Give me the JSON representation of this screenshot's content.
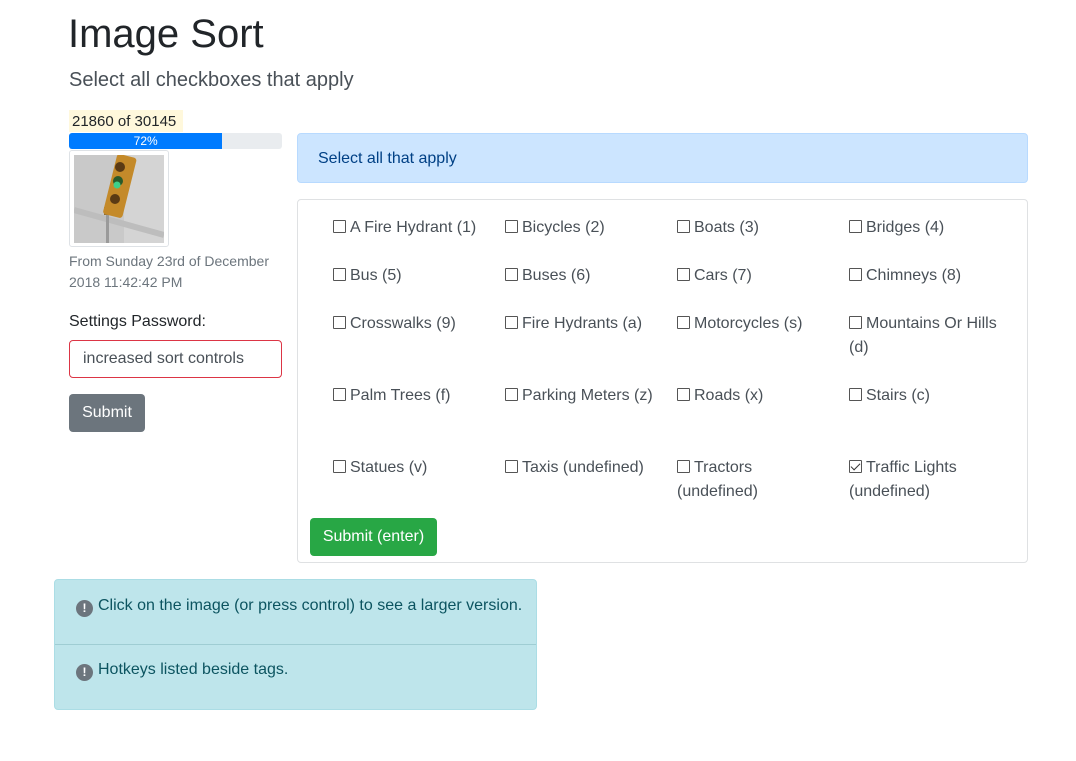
{
  "header": {
    "title": "Image Sort",
    "subtitle": "Select all checkboxes that apply"
  },
  "progress": {
    "counter": "21860 of 30145",
    "percent_label": "72%",
    "fraction": 0.72
  },
  "image": {
    "icon": "traffic-light-thumbnail",
    "caption": "From Sunday 23rd of December 2018 11:42:42 PM"
  },
  "settings": {
    "password_label": "Settings Password:",
    "password_value": "increased sort controls",
    "submit_label": "Submit"
  },
  "alert": {
    "text": "Select all that apply"
  },
  "tags": [
    {
      "label": "A Fire Hydrant (1)",
      "checked": false
    },
    {
      "label": "Bicycles (2)",
      "checked": false
    },
    {
      "label": "Boats (3)",
      "checked": false
    },
    {
      "label": "Bridges (4)",
      "checked": false
    },
    {
      "label": "Bus (5)",
      "checked": false
    },
    {
      "label": "Buses (6)",
      "checked": false
    },
    {
      "label": "Cars (7)",
      "checked": false
    },
    {
      "label": "Chimneys (8)",
      "checked": false
    },
    {
      "label": "Crosswalks (9)",
      "checked": false
    },
    {
      "label": "Fire Hydrants (a)",
      "checked": false
    },
    {
      "label": "Motorcycles (s)",
      "checked": false
    },
    {
      "label": "Mountains Or Hills (d)",
      "checked": false
    },
    {
      "label": "Palm Trees (f)",
      "checked": false
    },
    {
      "label": "Parking Meters (z)",
      "checked": false
    },
    {
      "label": "Roads (x)",
      "checked": false
    },
    {
      "label": "Stairs (c)",
      "checked": false
    },
    {
      "label": "Statues (v)",
      "checked": false
    },
    {
      "label": "Taxis (undefined)",
      "checked": false
    },
    {
      "label": "Tractors (undefined)",
      "checked": false
    },
    {
      "label": "Traffic Lights (undefined)",
      "checked": true
    }
  ],
  "tag_submit_label": "Submit (enter)",
  "info": {
    "line1": "Click on the image (or press control) to see a larger version.",
    "line2": "Hotkeys listed beside tags."
  },
  "colors": {
    "progress": "#007bff",
    "submit_green": "#28a745",
    "submit_gray": "#6c757d",
    "alert_blue": "#cce5ff",
    "info_teal": "#bee5eb",
    "input_border": "#dc3545"
  }
}
